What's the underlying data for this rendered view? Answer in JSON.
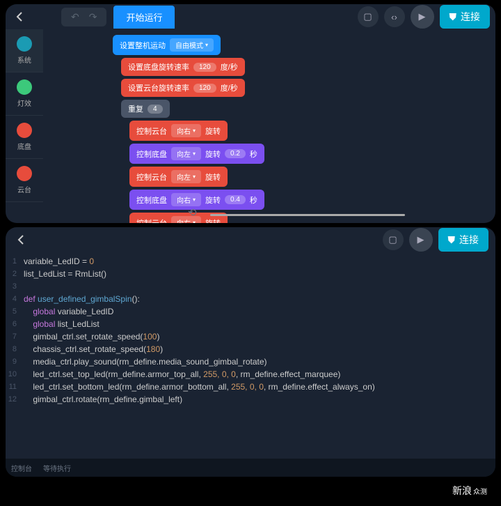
{
  "top": {
    "start_label": "开始运行",
    "connect_label": "连接",
    "sidebar": [
      {
        "label": "系统",
        "color": "#1b9bb3"
      },
      {
        "label": "灯效",
        "color": "#3cc97b"
      },
      {
        "label": "底盘",
        "color": "#e74c3c"
      },
      {
        "label": "云台",
        "color": "#e74c3c"
      }
    ],
    "blocks": {
      "set_robot_mode": "设置整机运动",
      "free_mode": "自由模式",
      "set_chassis_speed": "设置底盘旋转速率",
      "set_gimbal_speed": "设置云台旋转速率",
      "speed_val": "120",
      "deg_per_sec": "度/秒",
      "repeat": "重复",
      "repeat_n": "4",
      "ctrl_gimbal": "控制云台",
      "ctrl_chassis": "控制底盘",
      "dir_right": "向右",
      "dir_left": "向左",
      "rotate": "旋转",
      "sec": "秒",
      "d02": "0.2",
      "d04": "0.4"
    }
  },
  "bottom": {
    "connect_label": "连接",
    "console": "控制台",
    "waiting": "等待执行",
    "code": [
      {
        "n": 1,
        "t": "variable_LedID = ",
        "tail_num": "0"
      },
      {
        "n": 2,
        "t": "list_LedList = RmList()"
      },
      {
        "n": 3,
        "t": ""
      },
      {
        "n": 4,
        "kw": "def ",
        "fn": "user_defined_gimbalSpin",
        "t2": "():"
      },
      {
        "n": 5,
        "pad": "    ",
        "kw": "global",
        "t2": " variable_LedID"
      },
      {
        "n": 6,
        "pad": "    ",
        "kw": "global",
        "t2": " list_LedList"
      },
      {
        "n": 7,
        "pad": "    ",
        "t": "gimbal_ctrl.set_rotate_speed(",
        "num": "100",
        "t2": ")"
      },
      {
        "n": 8,
        "pad": "    ",
        "t": "chassis_ctrl.set_rotate_speed(",
        "num": "180",
        "t2": ")"
      },
      {
        "n": 9,
        "pad": "    ",
        "t": "media_ctrl.play_sound(rm_define.media_sound_gimbal_rotate)"
      },
      {
        "n": 10,
        "pad": "    ",
        "t": "led_ctrl.set_top_led(rm_define.armor_top_all, ",
        "args": "255, 0, 0",
        "t2": ", rm_define.effect_marquee)"
      },
      {
        "n": 11,
        "pad": "    ",
        "t": "led_ctrl.set_bottom_led(rm_define.armor_bottom_all, ",
        "args": "255, 0, 0",
        "t2": ", rm_define.effect_always_on)"
      },
      {
        "n": 12,
        "pad": "    ",
        "t": "gimbal_ctrl.rotate(rm_define.gimbal_left)"
      }
    ]
  },
  "watermark": {
    "brand": "新浪",
    "sub": "众测"
  }
}
